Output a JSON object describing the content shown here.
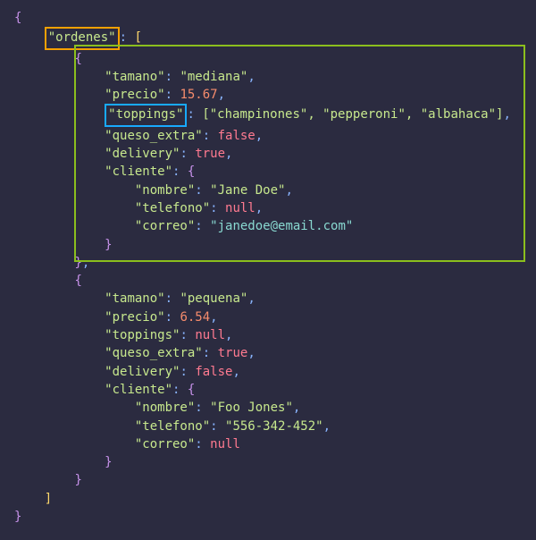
{
  "root_key": "\"ordenes\"",
  "orders": [
    {
      "tamano_key": "\"tamano\"",
      "tamano_val": "\"mediana\"",
      "precio_key": "\"precio\"",
      "precio_val": "15.67",
      "toppings_key": "\"toppings\"",
      "toppings_arr": "[\"champinones\", \"pepperoni\", \"albahaca\"]",
      "queso_key": "\"queso_extra\"",
      "queso_val": "false",
      "delivery_key": "\"delivery\"",
      "delivery_val": "true",
      "cliente_key": "\"cliente\"",
      "nombre_key": "\"nombre\"",
      "nombre_val": "\"Jane Doe\"",
      "telefono_key": "\"telefono\"",
      "telefono_val": "null",
      "correo_key": "\"correo\"",
      "correo_val": "\"janedoe@email.com\""
    },
    {
      "tamano_key": "\"tamano\"",
      "tamano_val": "\"pequena\"",
      "precio_key": "\"precio\"",
      "precio_val": "6.54",
      "toppings_key": "\"toppings\"",
      "toppings_val": "null",
      "queso_key": "\"queso_extra\"",
      "queso_val": "true",
      "delivery_key": "\"delivery\"",
      "delivery_val": "false",
      "cliente_key": "\"cliente\"",
      "nombre_key": "\"nombre\"",
      "nombre_val": "\"Foo Jones\"",
      "telefono_key": "\"telefono\"",
      "telefono_val": "\"556-342-452\"",
      "correo_key": "\"correo\"",
      "correo_val": "null"
    }
  ]
}
